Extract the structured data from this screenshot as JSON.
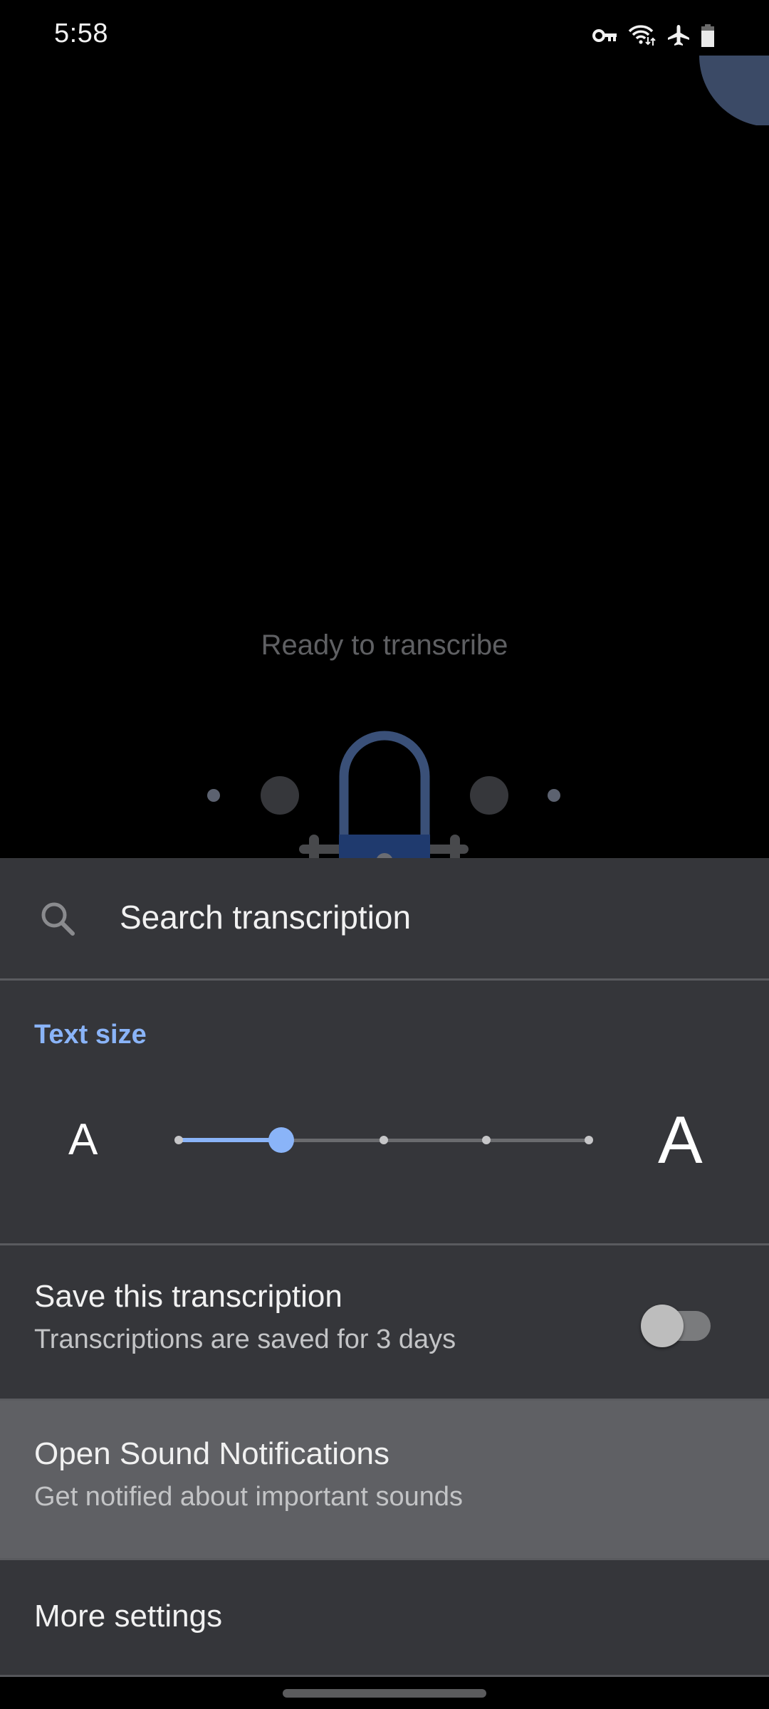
{
  "status_bar": {
    "time": "5:58",
    "icons": [
      "vpn-key-icon",
      "wifi-data-icon",
      "airplane-mode-icon",
      "battery-icon"
    ]
  },
  "transcribe": {
    "status_text": "Ready to transcribe",
    "illustration": "microphone-listening-illustration"
  },
  "sheet": {
    "search": {
      "icon": "search-icon",
      "placeholder": "Search transcription"
    },
    "text_size": {
      "label": "Text size",
      "small_glyph": "A",
      "large_glyph": "A",
      "steps": 5,
      "selected_step": 2
    },
    "save": {
      "title": "Save this transcription",
      "subtitle": "Transcriptions are saved for 3 days",
      "enabled": false
    },
    "sound_notifications": {
      "title": "Open Sound Notifications",
      "subtitle": "Get notified about important sounds",
      "highlighted": true
    },
    "more_settings": {
      "title": "More settings"
    }
  },
  "colors": {
    "accent": "#8ab4f8",
    "sheet_background": "#35363a",
    "highlight_row": "#5f6064",
    "illustration_blue": "#1f3a6e"
  }
}
